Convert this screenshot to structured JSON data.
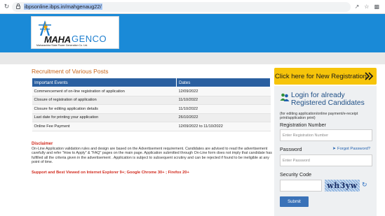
{
  "browser": {
    "url": "ibpsonline.ibps.in/mahgenaug22/",
    "icons": [
      "share-icon",
      "bookmark-star-icon",
      "extensions-icon"
    ]
  },
  "header": {
    "logo_maha": "MAHA",
    "logo_genco": "GENCO",
    "logo_subtitle": "Maharashtra State Power Generation Co. Ltd.",
    "banner_color": "#1a8ad7"
  },
  "main": {
    "section_title": "Recruitment of Various Posts",
    "table": {
      "columns": [
        "Important Events",
        "Dates"
      ],
      "rows": [
        [
          "Commencement of on-line registration of application",
          "12/09/2022"
        ],
        [
          "Closure of registration of application",
          "11/10/2022"
        ],
        [
          "Closure for editing application details",
          "11/10/2022"
        ],
        [
          "Last date for printing your application",
          "26/10/2022"
        ],
        [
          "Online Fee Payment",
          "12/09/2022 to 11/10/2022"
        ]
      ]
    },
    "disclaimer_title": "Disclaimer",
    "disclaimer_text": "On-Line Application validation rules and design are based on the Advertisement requirement. Candidates are advised to read the advertisement carefully and refer \"How to Apply\" & \"FAQ\" pages on the main page. Application submitted through On-Line form does not imply that candidate has fulfilled all the criteria given in the advertisement . Application is subject to subsequent scrutiny and can be rejected if found to be ineligible at any point of time.",
    "support_note": "Support and Best Viewed on Internet Explorer 9+; Google Chrome 30+ ; Firefox 20+"
  },
  "sidebar": {
    "new_registration_label": "Click here for New Registration",
    "login_title": "Login for already Registered Candidates",
    "login_note": "(for editing application/online payment/e-receipt print/application print)",
    "registration_label": "Registration Number",
    "registration_placeholder": "Enter Registration Number",
    "password_label": "Password",
    "forgot_password": "Forgot Password?",
    "password_placeholder": "Enter Password",
    "security_label": "Security Code",
    "captcha_text": "wh3yw",
    "submit_label": "Submit",
    "accent_color": "#f6c40a"
  }
}
